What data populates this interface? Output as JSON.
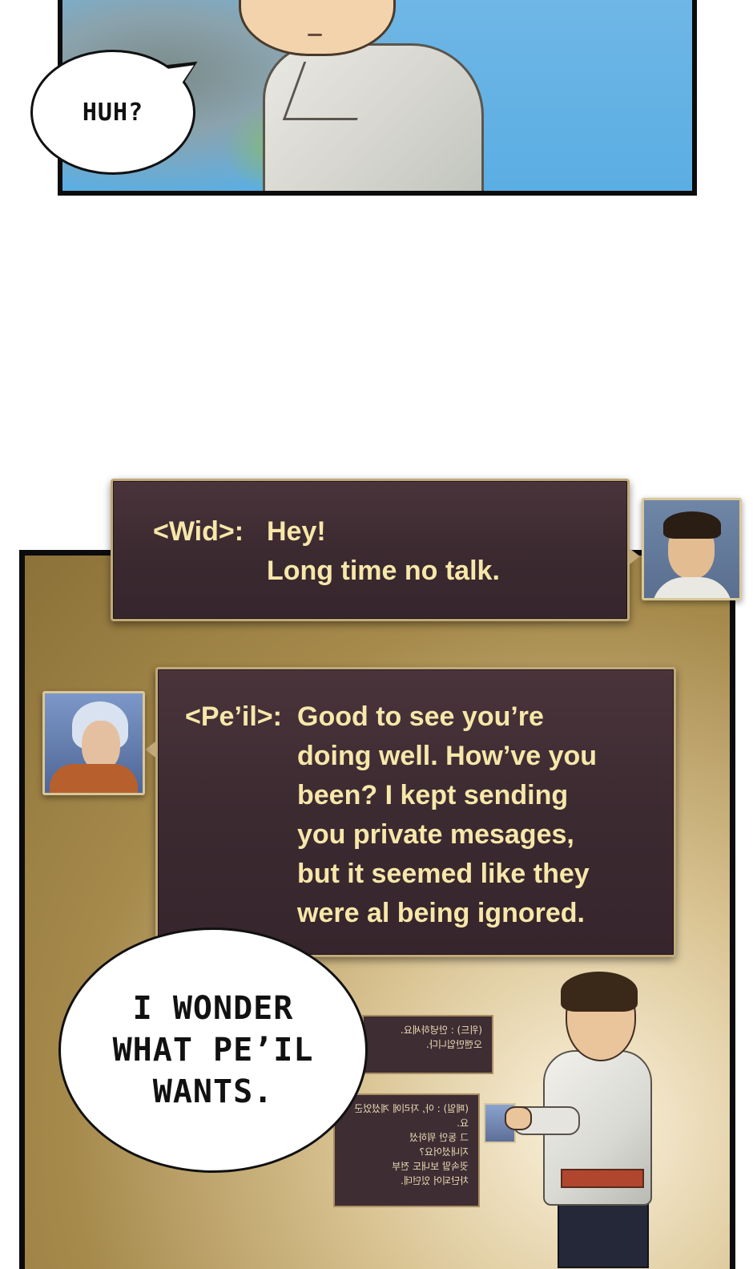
{
  "top_panel": {
    "speech_bubble": "HUH?"
  },
  "bottom_panel": {
    "message_wid": {
      "speaker": "<Wid>:",
      "lines": [
        "Hey!",
        "Long time no talk."
      ]
    },
    "message_peil": {
      "speaker": "<Pe’il>:",
      "lines": [
        "Good to see you’re",
        "doing well. How’ve you",
        "been? I kept sending",
        "you private mesages,",
        "but it seemed like they",
        "were al being ignored."
      ]
    },
    "small_message_1": {
      "lines": [
        "(위드) : 안녕하세요.",
        "오랜만입니다."
      ]
    },
    "small_message_2": {
      "lines": [
        "(페일) : 아, 자리에 계셨었군요.",
        "그 동안 뭐하셨",
        "지내셨어요?",
        "귓속말 보내도 전부",
        "차단되어 있던데."
      ]
    },
    "speech_bubble": [
      "I WONDER",
      "WHAT PE’IL",
      "WANTS."
    ]
  }
}
